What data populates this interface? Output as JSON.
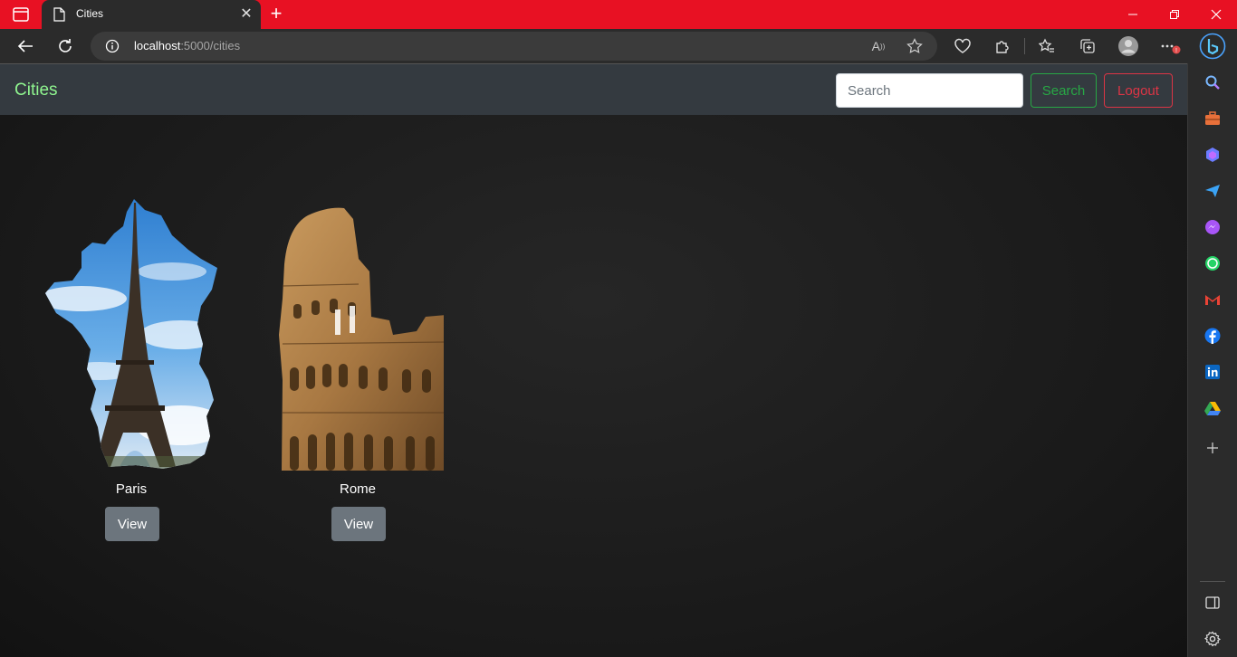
{
  "browser": {
    "tab_title": "Cities",
    "url_host": "localhost",
    "url_path": ":5000/cities"
  },
  "navbar": {
    "brand": "Cities",
    "search_placeholder": "Search",
    "search_button": "Search",
    "logout_button": "Logout"
  },
  "cities": [
    {
      "name": "Paris",
      "button": "View"
    },
    {
      "name": "Rome",
      "button": "View"
    }
  ],
  "colors": {
    "brand": "#8ff58f",
    "search_outline": "#28a745",
    "logout_outline": "#dc3545",
    "view_button": "#6c757d",
    "titlebar": "#e81123"
  },
  "sidebar_icons": [
    "search-icon",
    "toolbox-icon",
    "copilot-icon",
    "send-icon",
    "messenger-icon",
    "whatsapp-icon",
    "gmail-icon",
    "facebook-icon",
    "linkedin-icon",
    "drive-icon",
    "add-icon",
    "sidebar-toggle-icon",
    "settings-icon"
  ]
}
